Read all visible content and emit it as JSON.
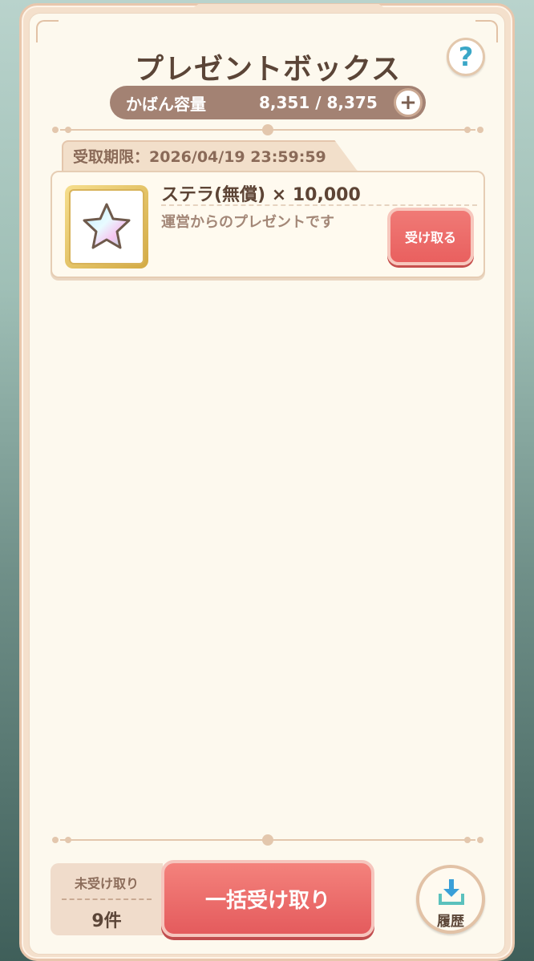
{
  "header": {
    "title": "プレゼントボックス",
    "help_symbol": "?"
  },
  "capacity": {
    "label": "かばん容量",
    "value": "8,351 / 8,375",
    "plus_symbol": "+"
  },
  "presents": [
    {
      "deadline": "受取期限：2026/04/19 23:59:59",
      "name": "ステラ(無償) × 10,000",
      "description": "運営からのプレゼントです",
      "receive_label": "受け取る",
      "icon": "star-icon"
    }
  ],
  "footer": {
    "unreceived_label": "未受け取り",
    "unreceived_count": "9件",
    "bulk_receive_label": "一括受け取り",
    "history_label": "履歴"
  },
  "colors": {
    "accent_red": "#e9605f",
    "text_brown": "#5b4537",
    "capacity_bg": "#a38273",
    "help_blue": "#3aa7c7",
    "history_teal": "#5bc1bd"
  }
}
